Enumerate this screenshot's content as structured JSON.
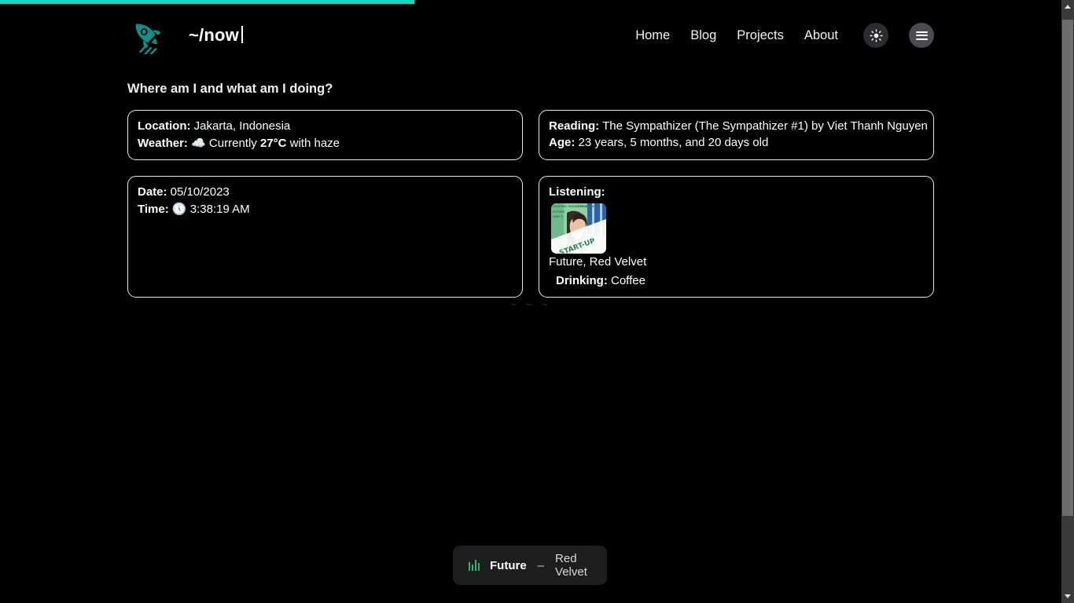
{
  "progress": {
    "percent": 39
  },
  "header": {
    "logo_icon": "rocket-icon",
    "title": "~/now",
    "nav": [
      {
        "label": "Home"
      },
      {
        "label": "Blog"
      },
      {
        "label": "Projects"
      },
      {
        "label": "About"
      }
    ],
    "theme_toggle_icon": "sun-icon",
    "menu_toggle_icon": "hamburger-icon"
  },
  "main": {
    "heading": "Where am I and what am I doing?",
    "cards": {
      "location": {
        "location_label": "Location:",
        "location_value": " Jakarta, Indonesia",
        "weather_label": "Weather:",
        "weather_icon": "cloud-icon",
        "weather_prefix": " Currently ",
        "weather_temp": "27°C",
        "weather_suffix": " with haze"
      },
      "reading": {
        "reading_label": "Reading:",
        "reading_value": " The Sympathizer (The Sympathizer #1) by Viet Thanh Nguyen",
        "age_label": "Age:",
        "age_value": " 23 years, 5 months, and 20 days old"
      },
      "datetime": {
        "date_label": "Date:",
        "date_value": " 05/10/2023",
        "time_label": "Time:",
        "time_icon": "clock-icon",
        "time_value": " 3:38:19 AM"
      },
      "listening": {
        "listening_label": "Listening:",
        "album_art_alt": "album-art-start-up",
        "track_line": "Future, Red Velvet",
        "drinking_label": "Drinking:",
        "drinking_value": " Coffee"
      }
    },
    "divider": "~ ~ ~"
  },
  "toast": {
    "equalizer_icon": "equalizer-icon",
    "track": "Future",
    "separator": "–",
    "artist": "Red Velvet"
  },
  "scrollbar": {
    "up_icon": "scroll-up-arrow-icon",
    "down_icon": "scroll-down-arrow-icon"
  },
  "colors": {
    "background": "#000000",
    "accent_teal": "#19d3c5",
    "logo_teal": "#0f8f87",
    "card_border": "#e8e8e8",
    "toast_bg": "#1d1e20",
    "equalizer_green": "#3bb36a"
  }
}
